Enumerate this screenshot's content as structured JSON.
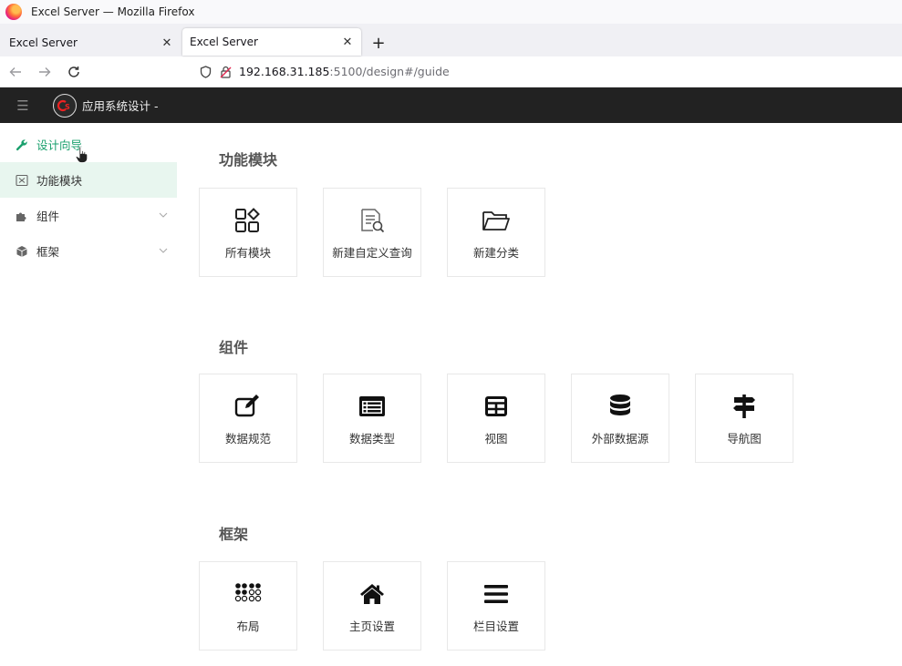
{
  "browser": {
    "window_title": "Excel Server — Mozilla Firefox",
    "tabs": [
      {
        "title": "Excel Server",
        "active": false
      },
      {
        "title": "Excel Server",
        "active": true
      }
    ],
    "url_host": "192.168.31.185",
    "url_rest": ":5100/design#/guide"
  },
  "app": {
    "title": "应用系统设计 -"
  },
  "sidebar": {
    "items": [
      {
        "label": "设计向导",
        "icon": "wrench-icon"
      },
      {
        "label": "功能模块",
        "icon": "module-icon"
      },
      {
        "label": "组件",
        "icon": "puzzle-icon"
      },
      {
        "label": "框架",
        "icon": "cube-icon"
      }
    ]
  },
  "sections": [
    {
      "title": "功能模块",
      "cards": [
        {
          "label": "所有模块",
          "icon": "apps-icon"
        },
        {
          "label": "新建自定义查询",
          "icon": "document-search-icon"
        },
        {
          "label": "新建分类",
          "icon": "folder-open-icon"
        }
      ]
    },
    {
      "title": "组件",
      "cards": [
        {
          "label": "数据规范",
          "icon": "edit-icon"
        },
        {
          "label": "数据类型",
          "icon": "list-alt-icon"
        },
        {
          "label": "视图",
          "icon": "table-icon"
        },
        {
          "label": "外部数据源",
          "icon": "database-icon"
        },
        {
          "label": "导航图",
          "icon": "signpost-icon"
        }
      ]
    },
    {
      "title": "框架",
      "cards": [
        {
          "label": "布局",
          "icon": "layout-dots-icon"
        },
        {
          "label": "主页设置",
          "icon": "home-icon"
        },
        {
          "label": "栏目设置",
          "icon": "menu-bars-icon"
        }
      ]
    }
  ],
  "colors": {
    "accent": "#1aa06d",
    "selected_bg": "#e8f6ef",
    "appbar_bg": "#222222"
  }
}
